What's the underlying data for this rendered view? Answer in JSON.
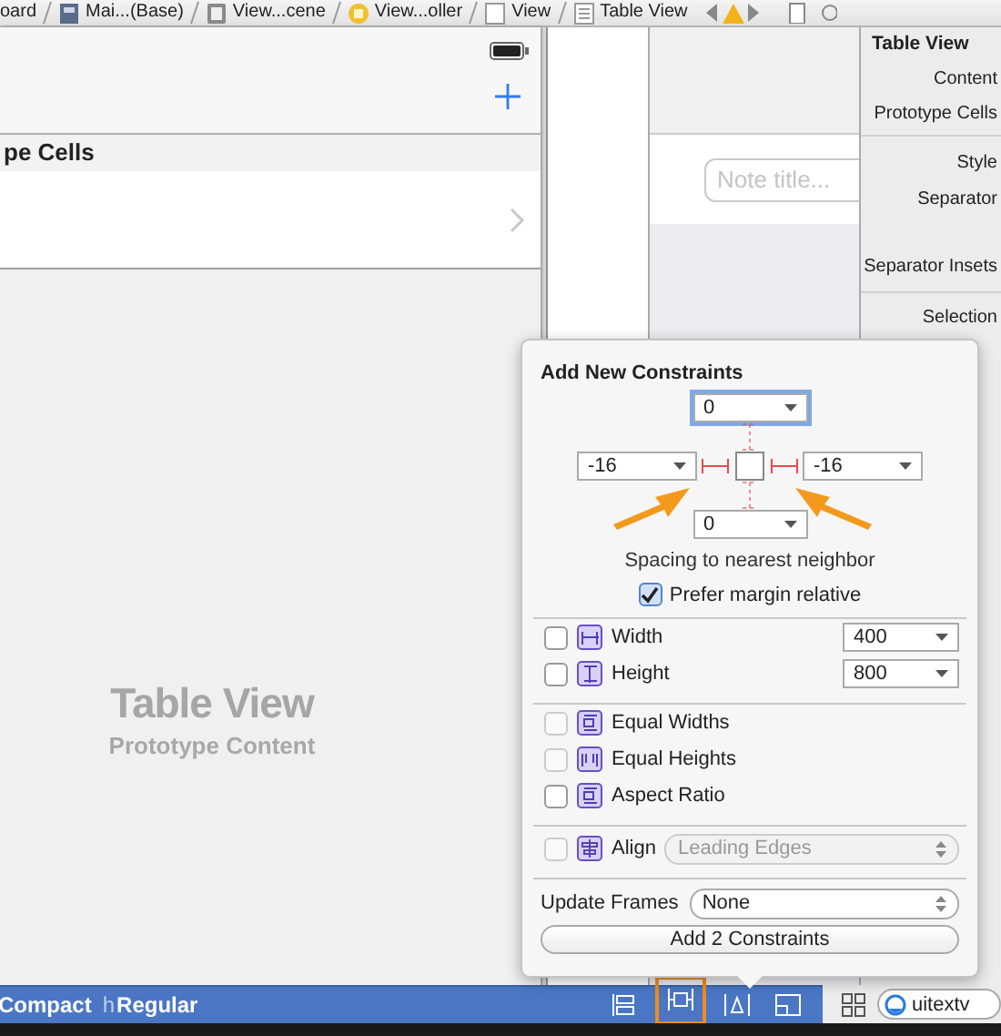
{
  "breadcrumbs": [
    {
      "label": "oard"
    },
    {
      "label": "Mai...(Base)"
    },
    {
      "label": "View...cene"
    },
    {
      "label": "View...oller"
    },
    {
      "label": "View"
    },
    {
      "label": "Table View"
    }
  ],
  "scene": {
    "section_header": "pe Cells",
    "placeholder_title": "Table View",
    "placeholder_subtitle": "Prototype Content"
  },
  "note_field": {
    "placeholder": "Note title..."
  },
  "inspector": {
    "title": "Table View",
    "labels": [
      "Content",
      "Prototype Cells",
      "Style",
      "Separator",
      "Separator Insets",
      "Selection"
    ]
  },
  "size_class": {
    "width_value": "Compact",
    "height_prefix": "h",
    "height_value": "Regular"
  },
  "layout_buttons": [
    {
      "kind": "stack",
      "selected": false
    },
    {
      "kind": "pin",
      "selected": true
    },
    {
      "kind": "resolve",
      "selected": false
    },
    {
      "kind": "resize",
      "selected": false
    }
  ],
  "search": {
    "value": "uitextv"
  },
  "popover": {
    "title": "Add New Constraints",
    "spacing": [
      {
        "value": "0",
        "pinned": false
      },
      {
        "value": "-16",
        "pinned": true
      },
      {
        "value": "-16",
        "pinned": true
      },
      {
        "value": "0",
        "pinned": false
      }
    ],
    "spacing_caption": "Spacing to nearest neighbor",
    "prefer_margin": {
      "label": "Prefer margin relative",
      "checked": true
    },
    "size_rows": [
      {
        "label": "Width",
        "checked": false,
        "value": "400"
      },
      {
        "label": "Height",
        "checked": false,
        "value": "800"
      }
    ],
    "equal_rows": [
      {
        "label": "Equal Widths",
        "checked": false,
        "disabled": true
      },
      {
        "label": "Equal Heights",
        "checked": false,
        "disabled": true
      },
      {
        "label": "Aspect Ratio",
        "checked": false,
        "disabled": false
      }
    ],
    "align": {
      "label": "Align",
      "checked": false,
      "disabled": true,
      "value": "Leading Edges"
    },
    "update_frames": {
      "label": "Update Frames",
      "value": "None"
    },
    "add_button": "Add 2 Constraints"
  }
}
